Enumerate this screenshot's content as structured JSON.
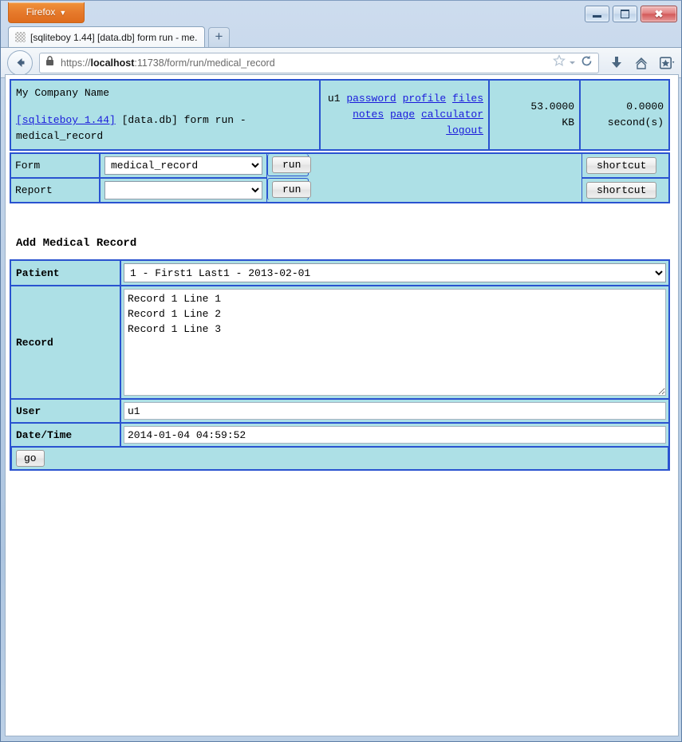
{
  "window": {
    "firefox_button": "Firefox",
    "minimize_label": "Minimize",
    "maximize_label": "Maximize",
    "close_label": "Close"
  },
  "tabs": [
    {
      "title": "[sqliteboy 1.44] [data.db] form run - me...",
      "favicon": "blank-favicon"
    }
  ],
  "newtab_label": "+",
  "navbar": {
    "back_label": "Back",
    "lock_icon": "lock-icon",
    "url_prefix": "https://",
    "url_host": "localhost",
    "url_rest": ":11738/form/run/medical_record",
    "full_url": "https://localhost:11738/form/run/medical_record",
    "bookmark_icon": "star-icon",
    "reload_icon": "reload-icon",
    "downloads_icon": "download-arrow-icon",
    "home_icon": "home-icon",
    "bookmarks_icon": "bookmarks-menu-icon"
  },
  "header": {
    "company": "My Company Name",
    "app_link": "[sqliteboy 1.44]",
    "context": " [data.db] form run - medical_record",
    "user": "u1",
    "links": [
      "password",
      "profile",
      "files",
      "notes",
      "page",
      "calculator",
      "logout"
    ],
    "memory_value": "53.0000",
    "memory_unit": "KB",
    "time_value": "0.0000",
    "time_unit": "second(s)"
  },
  "selector": {
    "form_label": "Form",
    "form_value": "medical_record",
    "form_run": "run",
    "form_shortcut": "shortcut",
    "report_label": "Report",
    "report_value": "",
    "report_run": "run",
    "report_shortcut": "shortcut"
  },
  "form": {
    "title": "Add Medical Record",
    "fields": [
      {
        "label": "Patient",
        "type": "select",
        "value": "1 - First1 Last1 - 2013-02-01"
      },
      {
        "label": "Record",
        "type": "textarea",
        "value": "Record 1 Line 1\nRecord 1 Line 2\nRecord 1 Line 3"
      },
      {
        "label": "User",
        "type": "text",
        "value": "u1"
      },
      {
        "label": "Date/Time",
        "type": "text",
        "value": "2014-01-04 04:59:52"
      }
    ],
    "submit_label": "go"
  },
  "colors": {
    "panel_cyan": "#ade0e6",
    "border_blue": "#2a53d0",
    "link_blue": "#1a1adb",
    "firefox_orange": "#e5782a"
  }
}
